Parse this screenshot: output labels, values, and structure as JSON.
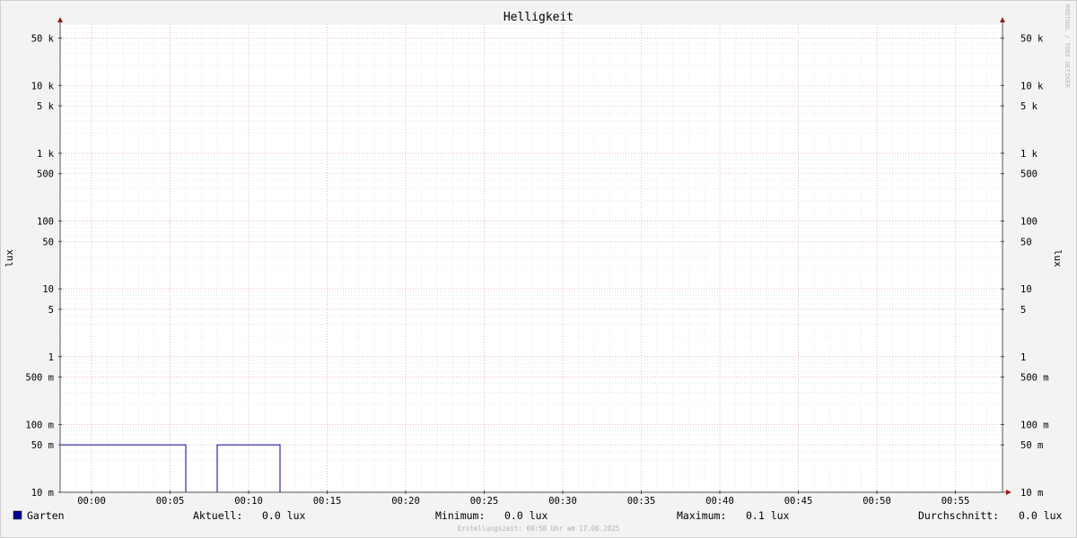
{
  "chart_data": {
    "type": "line",
    "title": "Helligkeit",
    "ylabel_left": "lux",
    "ylabel_right": "lux",
    "yscale": "log",
    "ylim": [
      0.01,
      80000
    ],
    "y_ticks": [
      {
        "value": 50000,
        "label": "50 k"
      },
      {
        "value": 10000,
        "label": "10 k"
      },
      {
        "value": 5000,
        "label": "5 k"
      },
      {
        "value": 1000,
        "label": "1 k"
      },
      {
        "value": 500,
        "label": "500"
      },
      {
        "value": 100,
        "label": "100"
      },
      {
        "value": 50,
        "label": "50"
      },
      {
        "value": 10,
        "label": "10"
      },
      {
        "value": 5,
        "label": "5"
      },
      {
        "value": 1,
        "label": "1"
      },
      {
        "value": 0.5,
        "label": "500 m"
      },
      {
        "value": 0.1,
        "label": "100 m"
      },
      {
        "value": 0.05,
        "label": "50 m"
      },
      {
        "value": 0.01,
        "label": "10 m"
      }
    ],
    "x_ticks": [
      "00:00",
      "00:05",
      "00:10",
      "00:15",
      "00:20",
      "00:25",
      "00:30",
      "00:35",
      "00:40",
      "00:45",
      "00:50",
      "00:55"
    ],
    "xlim_minutes": [
      -2,
      58
    ],
    "grid": true,
    "series": [
      {
        "name": "Garten",
        "color": "#000099",
        "points": [
          [
            -2,
            0.05
          ],
          [
            6,
            0.05
          ],
          [
            6,
            0.01
          ],
          [
            8,
            0.01
          ],
          [
            8,
            0.05
          ],
          [
            12,
            0.05
          ],
          [
            12,
            0.01
          ],
          [
            58,
            0.01
          ]
        ]
      }
    ],
    "watermark": "RRDTOOL / TOBI OETIKER",
    "footer": "Erstellungszeit: 00:58 Uhr am 17.06.2025"
  },
  "legend": {
    "series_label": "Garten",
    "series_color": "#000099",
    "aktuell_label": "Aktuell:",
    "aktuell_value": "0.0 lux",
    "minimum_label": "Minimum:",
    "minimum_value": "0.0 lux",
    "maximum_label": "Maximum:",
    "maximum_value": "0.1 lux",
    "durchschnitt_label": "Durchschnitt:",
    "durchschnitt_value": "0.0 lux"
  }
}
